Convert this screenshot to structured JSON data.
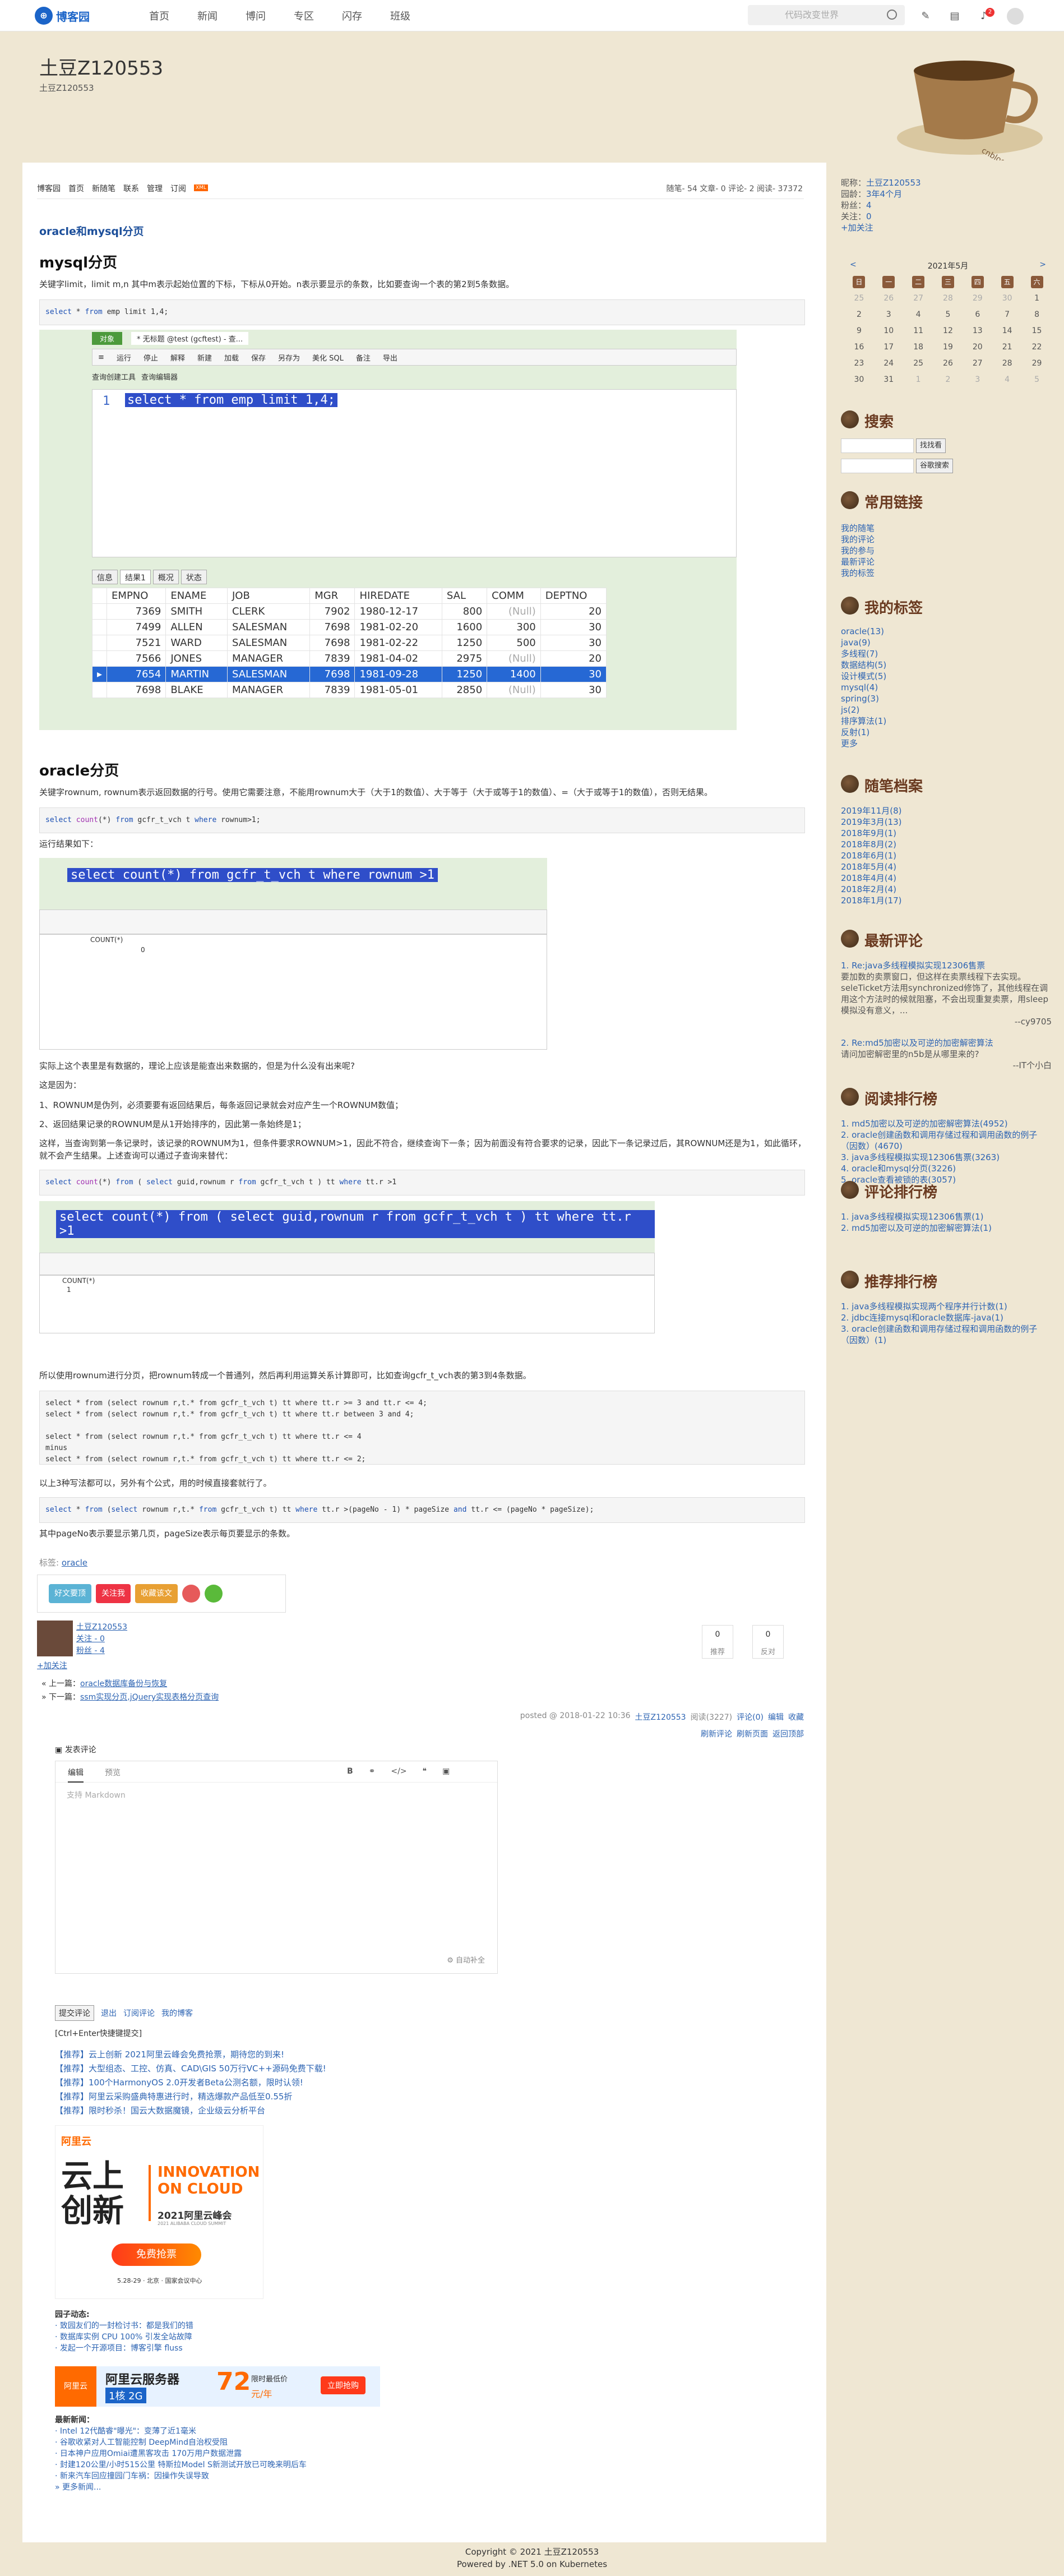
{
  "topnav": {
    "logo": "博客园",
    "links": [
      "首页",
      "新闻",
      "博问",
      "专区",
      "闪存",
      "班级"
    ],
    "search_placeholder": "代码改变世界",
    "notif_count": "2"
  },
  "header": {
    "title": "土豆Z120553",
    "url": "土豆Z120553"
  },
  "subnav": {
    "items": [
      "博客园",
      "首页",
      "新随笔",
      "联系",
      "管理",
      "订阅"
    ],
    "rss": "XML"
  },
  "stats": "随笔- 54  文章- 0  评论- 2  阅读- 37372",
  "post": {
    "title": "oracle和mysql分页",
    "h_mysql": "mysql分页",
    "p1": "关键字limit，limit m,n 其中m表示起始位置的下标，下标从0开始。n表示要显示的条数，比如要查询一个表的第2到5条数据。",
    "code1": "select * from emp limit 1,4;",
    "shot1": {
      "tab_object": "对象",
      "tab_query": "* 无标题 @test (gcftest) - 查...",
      "toolbar": [
        "运行",
        "停止",
        "解释",
        "新建",
        "加载",
        "保存",
        "另存为",
        "美化 SQL",
        "备注",
        "导出"
      ],
      "subtoolbar": [
        "查询创建工具",
        "查询编辑器"
      ],
      "line_no": "1",
      "sql": "select * from emp limit 1,4;",
      "result_tabs": [
        "信息",
        "结果1",
        "概况",
        "状态"
      ],
      "columns": [
        "EMPNO",
        "ENAME",
        "JOB",
        "MGR",
        "HIREDATE",
        "SAL",
        "COMM",
        "DEPTNO"
      ],
      "rows": [
        [
          "7369",
          "SMITH",
          "CLERK",
          "7902",
          "1980-12-17",
          "800",
          "(Null)",
          "20"
        ],
        [
          "7499",
          "ALLEN",
          "SALESMAN",
          "7698",
          "1981-02-20",
          "1600",
          "300",
          "30"
        ],
        [
          "7521",
          "WARD",
          "SALESMAN",
          "7698",
          "1981-02-22",
          "1250",
          "500",
          "30"
        ],
        [
          "7566",
          "JONES",
          "MANAGER",
          "7839",
          "1981-04-02",
          "2975",
          "(Null)",
          "20"
        ],
        [
          "7654",
          "MARTIN",
          "SALESMAN",
          "7698",
          "1981-09-28",
          "1250",
          "1400",
          "30"
        ],
        [
          "7698",
          "BLAKE",
          "MANAGER",
          "7839",
          "1981-05-01",
          "2850",
          "(Null)",
          "30"
        ]
      ]
    },
    "h_oracle": "oracle分页",
    "p2": "关键字rownum, rownum表示返回数据的行号。使用它需要注意，不能用rownum大于（大于1的数值）、大于等于（大于或等于1的数值）、=（大于或等于1的数值），否则无结果。",
    "code2": "select count(*) from gcfr_t_vch t where rownum>1;",
    "p3": "运行结果如下：",
    "shot2": {
      "sql": "select count(*) from gcfr_t_vch t where rownum >1",
      "col": "COUNT(*)",
      "val": "0"
    },
    "p4": "实际上这个表里是有数据的，理论上应该是能查出来数据的，但是为什么没有出来呢?",
    "p5": "这是因为：",
    "p6": "1、ROWNUM是伪列，必须要要有返回结果后，每条返回记录就会对应产生一个ROWNUM数值；",
    "p7": "2、返回结果记录的ROWNUM是从1开始排序的，因此第一条始终是1；",
    "p8": "这样，当查询到第一条记录时，该记录的ROWNUM为1，但条件要求ROWNUM>1，因此不符合，继续查询下一条；因为前面没有符合要求的记录，因此下一条记录过后，其ROWNUM还是为1，如此循环，就不会产生结果。上述查询可以通过子查询来替代：",
    "code3": "select count(*) from ( select guid,rownum r from gcfr_t_vch t ) tt where tt.r >1",
    "shot3": {
      "sql": "select count(*) from ( select guid,rownum r from gcfr_t_vch t ) tt where tt.r >1",
      "col": "COUNT(*)",
      "val": "1"
    },
    "p9": "所以使用rownum进行分页，把rownum转成一个普通列，然后再利用运算关系计算即可，比如查询gcfr_t_vch表的第3到4条数据。",
    "code4": [
      "select * from (select rownum r,t.* from gcfr_t_vch t) tt where tt.r >= 3 and tt.r <= 4;",
      "select * from (select rownum r,t.* from gcfr_t_vch t) tt where tt.r between 3 and 4;",
      "",
      "select * from (select rownum r,t.* from gcfr_t_vch t) tt where  tt.r <= 4",
      "minus",
      "select * from (select rownum r,t.* from gcfr_t_vch t) tt where  tt.r <= 2;"
    ],
    "p10": "以上3种写法都可以，另外有个公式，用的时候直接套就行了。",
    "code5": "select * from (select rownum r,t.* from gcfr_t_vch t) tt where tt.r >(pageNo - 1) * pageSize and tt.r <= (pageNo * pageSize);",
    "p11": "其中pageNo表示要显示第几页，pageSize表示每页要显示的条数。",
    "tags_label": "标签:",
    "tag": "oracle"
  },
  "share": {
    "buttons": [
      "好文要顶",
      "关注我",
      "收藏该文"
    ]
  },
  "author": {
    "name": "土豆Z120553",
    "follow": "关注 - 0",
    "fans": "粉丝 - 4",
    "add_follow": "+加关注",
    "recommend_n": "0",
    "recommend_l": "推荐",
    "oppose_n": "0",
    "oppose_l": "反对"
  },
  "prevnext": {
    "prev_label": "« 上一篇：",
    "prev": "oracle数据库备份与恢复",
    "next_label": "» 下一篇：",
    "next": "ssm实现分页,jQuery实现表格分页查询"
  },
  "postmeta": {
    "posted": "posted @ 2018-01-22 10:36",
    "author": "土豆Z120553",
    "reads": "阅读(3227)",
    "comments": "评论(0)",
    "edit": "编辑",
    "collect": "收藏"
  },
  "commentlinks": [
    "刷新评论",
    "刷新页面",
    "返回顶部"
  ],
  "comment": {
    "title": "发表评论",
    "tab_edit": "编辑",
    "tab_preview": "预览",
    "placeholder": "支持 Markdown",
    "autosave": "自动补全",
    "submit": "提交评论",
    "logout": "退出",
    "subscribe": "订阅评论",
    "mine": "我的博客",
    "ctrl": "[Ctrl+Enter快捷键提交]"
  },
  "ads": [
    "【推荐】云上创新 2021阿里云峰会免费抢票，期待您的到来!",
    "【推荐】大型组态、工控、仿真、CAD\\GIS 50万行VC++源码免费下载!",
    "【推荐】100个HarmonyOS 2.0开发者Beta公测名额，限时认领!",
    "【推荐】阿里云采购盛典特惠进行时，精选爆款产品低至0.55折",
    "【推荐】限时秒杀！国云大数据魔镜，企业级云分析平台"
  ],
  "promo": {
    "brand": "阿里云",
    "line1": "INNOVATION",
    "line2": "ON CLOUD",
    "cn1": "云上",
    "cn2": "创新",
    "subtitle": "2021阿里云峰会",
    "sub2": "2021 ALIBABA CLOUD SUMMIT",
    "btn": "免费抢票",
    "date": "5.28-29 · 北京 · 国家会议中心"
  },
  "garden": {
    "title": "园子动态:",
    "items": [
      "· 致园友们的一封检讨书：都是我们的错",
      "· 数据库实例 CPU 100% 引发全站故障",
      "· 发起一个开源项目：博客引擎 fluss"
    ]
  },
  "banner2": {
    "brand": "阿里云",
    "title": "阿里云服务器",
    "spec": "1核 2G",
    "price": "72",
    "unit": "元/年",
    "tag": "限时最低价",
    "btn": "立即抢购"
  },
  "news": {
    "title": "最新新闻：",
    "items": [
      "· Intel 12代酷睿\"曝光\"：变薄了近1毫米",
      "· 谷歌收紧对人工智能控制 DeepMind自治权受阻",
      "· 日本神户应用Omiai遭黑客攻击 170万用户数据泄露",
      "· 封建120公里/小时515公里 特斯拉Model S新测试开放已可晚来明后车",
      "· 新来汽车回应撞园门车祸：因操作失误导致"
    ],
    "more": "» 更多新闻..."
  },
  "side": {
    "profile": [
      [
        "昵称：",
        "土豆Z120553"
      ],
      [
        "园龄：",
        "3年4个月"
      ],
      [
        "粉丝：",
        "4"
      ],
      [
        "关注：",
        "0"
      ]
    ],
    "add_follow": "+加关注",
    "cal_title": "2021年5月",
    "cal_prev": "<",
    "cal_next": ">",
    "cal_head": [
      "日",
      "一",
      "二",
      "三",
      "四",
      "五",
      "六"
    ],
    "cal_rows": [
      [
        "25",
        "26",
        "27",
        "28",
        "29",
        "30",
        "1"
      ],
      [
        "2",
        "3",
        "4",
        "5",
        "6",
        "7",
        "8"
      ],
      [
        "9",
        "10",
        "11",
        "12",
        "13",
        "14",
        "15"
      ],
      [
        "16",
        "17",
        "18",
        "19",
        "20",
        "21",
        "22"
      ],
      [
        "23",
        "24",
        "25",
        "26",
        "27",
        "28",
        "29"
      ],
      [
        "30",
        "31",
        "1",
        "2",
        "3",
        "4",
        "5"
      ]
    ],
    "search_title": "搜索",
    "search_btn": "找找看",
    "google_btn": "谷歌搜索",
    "links_title": "常用链接",
    "links": [
      "我的随笔",
      "我的评论",
      "我的参与",
      "最新评论",
      "我的标签"
    ],
    "tags_title": "我的标签",
    "tags": [
      "oracle(13)",
      "java(9)",
      "多线程(7)",
      "数据结构(5)",
      "设计模式(5)",
      "mysql(4)",
      "spring(3)",
      "js(2)",
      "排序算法(1)",
      "反射(1)",
      "更多"
    ],
    "archive_title": "随笔档案",
    "archive": [
      "2019年11月(8)",
      "2019年3月(13)",
      "2018年9月(1)",
      "2018年8月(2)",
      "2018年6月(1)",
      "2018年5月(4)",
      "2018年4月(4)",
      "2018年2月(4)",
      "2018年1月(17)"
    ],
    "comments_title": "最新评论",
    "comments": [
      {
        "title": "1. Re:java多线程模拟实现12306售票",
        "body": "要加数的卖票窗口，但这样在卖票线程下去实现。 seleTicket方法用synchronized修饰了，其他线程在调用这个方法时的候就阻塞，不会出现重复卖票，用sleep模拟没有意义，...",
        "by": "--cy9705"
      },
      {
        "title": "2. Re:md5加密以及可逆的加密解密算法",
        "body": "请问加密解密里的n5b是从哪里来的?",
        "by": "--IT个小白"
      }
    ],
    "reads_title": "阅读排行榜",
    "reads": [
      "1. md5加密以及可逆的加密解密算法(4952)",
      "2. oracle创建函数和调用存储过程和调用函数的例子（因数）(4670)",
      "3. java多线程模拟实现12306售票(3263)",
      "4. oracle和mysql分页(3226)",
      "5. oracle查看被锁的表(3057)"
    ],
    "cmt_rank_title": "评论排行榜",
    "cmt_rank": [
      "1. java多线程模拟实现12306售票(1)",
      "2. md5加密以及可逆的加密解密算法(1)"
    ],
    "rec_title": "推荐排行榜",
    "rec": [
      "1. java多线程模拟实现两个程序并行计数(1)",
      "2. jdbc连接mysql和oracle数据库-java(1)",
      "3. oracle创建函数和调用存储过程和调用函数的例子（因数）(1)"
    ]
  },
  "footer": {
    "copyright": "Copyright © 2021 土豆Z120553",
    "powered": "Powered by .NET 5.0 on Kubernetes"
  }
}
